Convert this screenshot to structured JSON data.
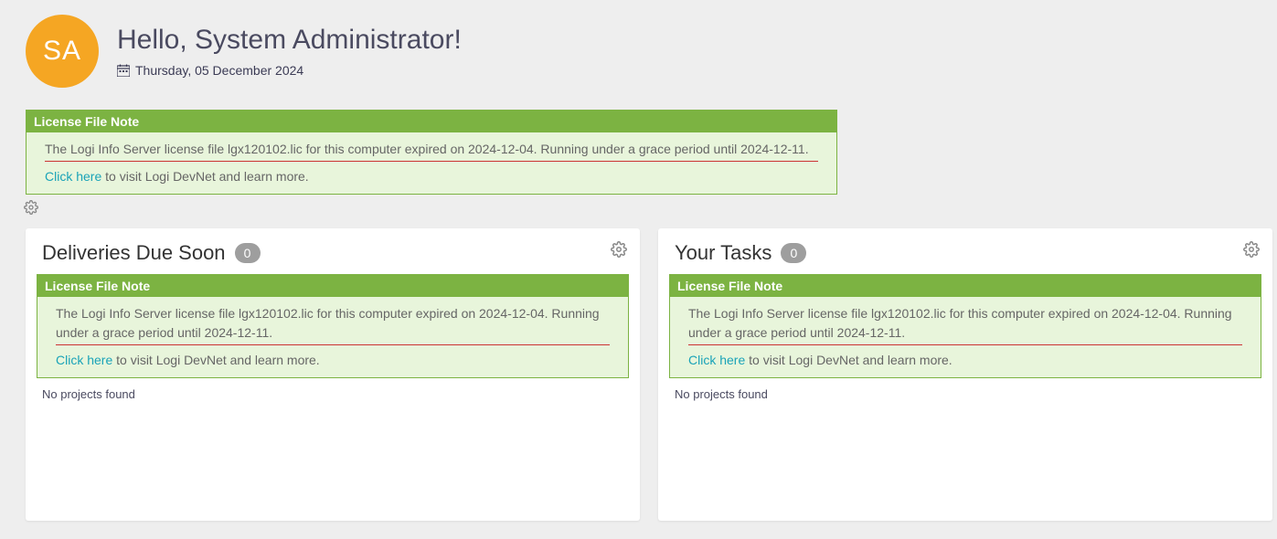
{
  "header": {
    "avatar_initials": "SA",
    "greeting": "Hello, System Administrator!",
    "date": "Thursday, 05 December 2024"
  },
  "license_note": {
    "title": "License File Note",
    "message": "The Logi Info Server license file lgx120102.lic for this computer expired on 2024-12-04. Running under a grace period until 2024-12-11.",
    "link_text": "Click here",
    "link_suffix": " to visit Logi DevNet and learn more."
  },
  "panels": {
    "deliveries": {
      "title": "Deliveries Due Soon",
      "count": "0",
      "empty": "No projects found"
    },
    "tasks": {
      "title": "Your Tasks",
      "count": "0",
      "empty": "No projects found"
    }
  }
}
